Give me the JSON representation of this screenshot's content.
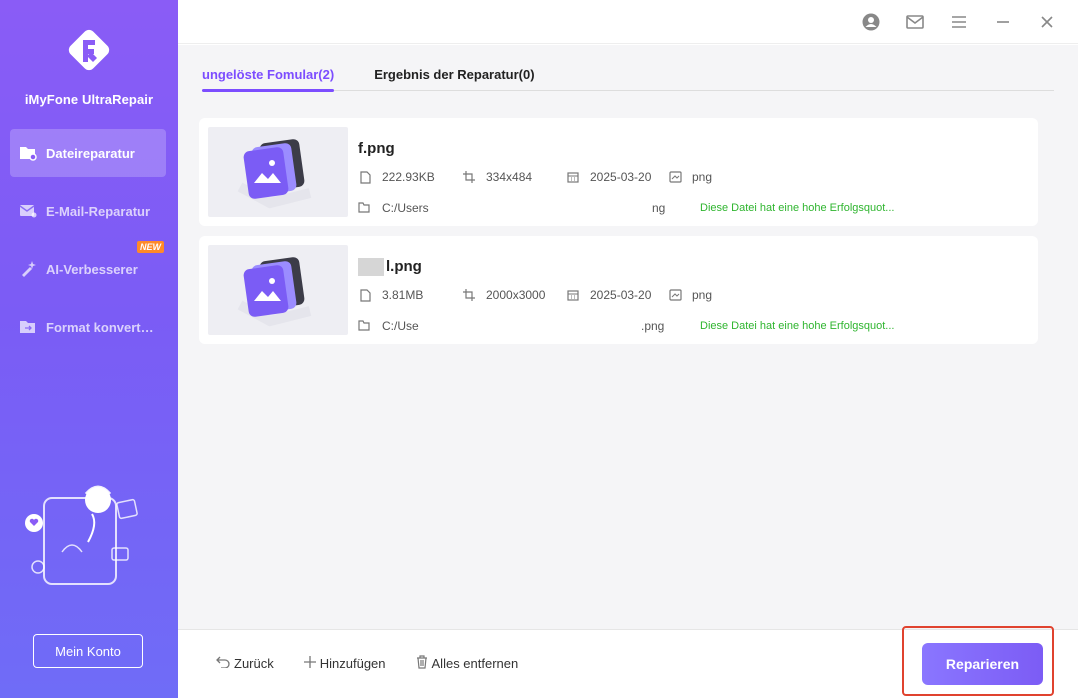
{
  "app": {
    "name": "iMyFone UltraRepair"
  },
  "sidebar": {
    "items": [
      {
        "label": "Dateireparatur",
        "active": true,
        "icon": "file-repair-icon"
      },
      {
        "label": "E-Mail-Reparatur",
        "active": false,
        "icon": "email-repair-icon"
      },
      {
        "label": "AI-Verbesserer",
        "active": false,
        "icon": "ai-enhance-icon",
        "badge": "NEW"
      },
      {
        "label": "Format konvert…",
        "active": false,
        "icon": "format-convert-icon"
      }
    ],
    "account_label": "Mein Konto"
  },
  "tabs": [
    {
      "label": "ungelöste Fomular(2)",
      "active": true
    },
    {
      "label": "Ergebnis der Reparatur(0)",
      "active": false
    }
  ],
  "files": [
    {
      "name_suffix": "f.png",
      "size": "222.93KB",
      "dimensions": "334x484",
      "date": "2025-03-20",
      "type": "png",
      "path_start": "C:/Users",
      "path_end": "ng",
      "status": "Diese Datei hat eine hohe Erfolgsquot..."
    },
    {
      "name_suffix": "l.png",
      "size": "3.81MB",
      "dimensions": "2000x3000",
      "date": "2025-03-20",
      "type": "png",
      "path_start": "C:/Use",
      "path_end": ".png",
      "status": "Diese Datei hat eine hohe Erfolgsquot..."
    }
  ],
  "bottom": {
    "back_label": "Zurück",
    "add_label": "Hinzufügen",
    "remove_all_label": "Alles entfernen",
    "repair_label": "Reparieren"
  },
  "colors": {
    "accent": "#7c4dff",
    "success": "#2fb52f",
    "highlight": "#e0432f"
  }
}
